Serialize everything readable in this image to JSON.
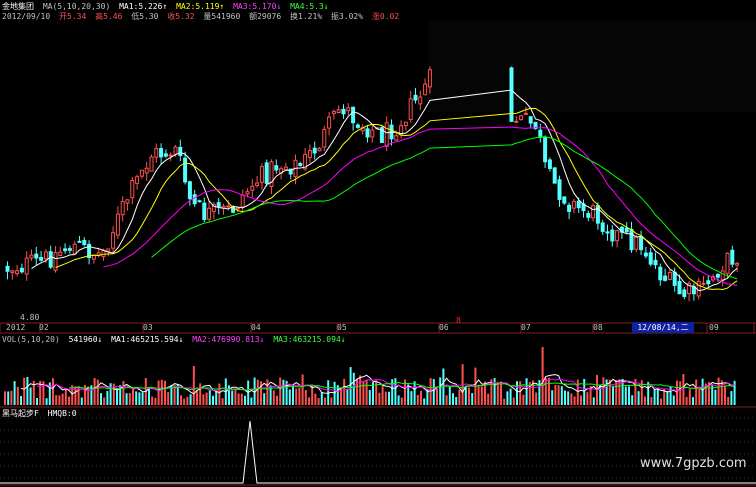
{
  "header": {
    "stock_name": "金地集团",
    "ma_label": "MA(5,10,20,30)",
    "ma1": "MA1:5.226↑",
    "ma2": "MA2:5.119↑",
    "ma3": "MA3:5.170↓",
    "ma4": "MA4:5.3↓",
    "date": "2012/09/10",
    "open": "开5.34",
    "high": "高5.46",
    "low": "低5.30",
    "close": "收5.32",
    "volume": "量541960",
    "amount": "额29076",
    "turnover": "换1.21%",
    "amplitude": "振3.02%",
    "change": "涨0.02"
  },
  "vol_header": {
    "label": "VOL(5,10,20)",
    "value": "541960↓",
    "ma1": "MA1:465215.594↓",
    "ma2": "MA2:476990.813↓",
    "ma3": "MA3:463215.094↓"
  },
  "ind_header": {
    "label": "黑马起步F",
    "value": "HMQB:0"
  },
  "price_low_label": "4.80",
  "x_ticks": [
    "2012",
    "02",
    "03",
    "04",
    "05",
    "06",
    "07",
    "08",
    "09"
  ],
  "cursor_date": "12/08/14,二",
  "marker": "8",
  "watermark": "www.7gpzb.com",
  "colors": {
    "up": "#ff5050",
    "down": "#54ffff",
    "ma1": "#ffffff",
    "ma2": "#ffff00",
    "ma3": "#ff00ff",
    "ma4": "#00ff00",
    "grid": "#802020"
  },
  "chart_data": {
    "type": "candlestick",
    "price_min_label": 4.8,
    "months": [
      "2012",
      "02",
      "03",
      "04",
      "05",
      "06",
      "07",
      "08",
      "09"
    ],
    "last_bar": {
      "open": 5.34,
      "high": 5.46,
      "low": 5.3,
      "close": 5.32,
      "volume": 541960
    },
    "ma_last": {
      "ma5": 5.226,
      "ma10": 5.119,
      "ma20": 5.17,
      "ma30": 5.3
    },
    "vol_ma_last": {
      "ma5": 465215.594,
      "ma10": 476990.813,
      "ma20": 463215.094
    },
    "indicator": {
      "name": "黑马起步F",
      "HMQB": 0
    }
  }
}
